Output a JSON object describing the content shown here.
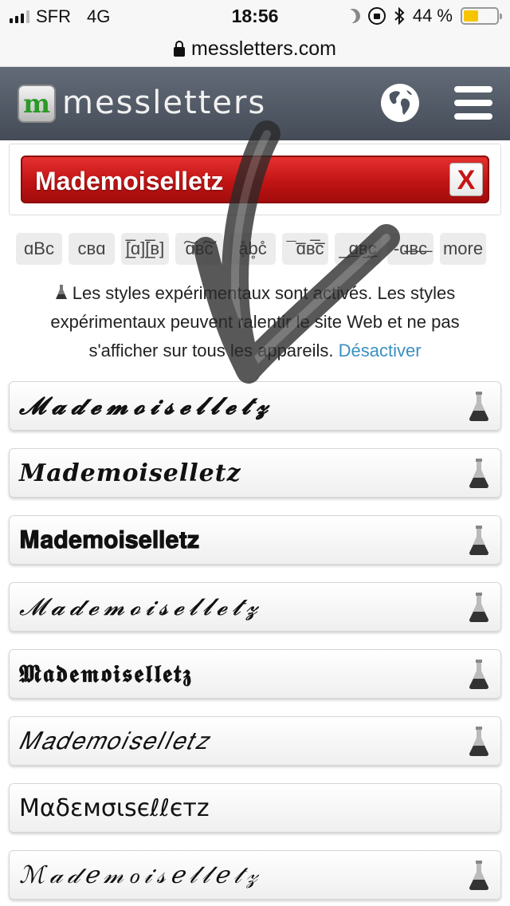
{
  "status": {
    "carrier": "SFR",
    "network": "4G",
    "time": "18:56",
    "battery": "44 %",
    "battery_level": 0.44
  },
  "browser": {
    "url": "messletters.com"
  },
  "header": {
    "brand": "messletters",
    "globe_icon": "globe-icon",
    "menu_icon": "hamburger-menu-icon"
  },
  "input": {
    "value": "Mademoiselletz",
    "clear_label": "X"
  },
  "chips": [
    "ɑBc",
    "cвɑ",
    "[̲̅ɑ][̲̅в]",
    "͠ɑв͠c",
    "ạ̊b̥c̊",
    "¯ɑ̅в̅c̅",
    "_ɑ̲в̲c̲",
    "-ɑ̶в̶c̶",
    "more"
  ],
  "notice": {
    "text": "Les styles expérimentaux sont activés. Les styles expérimentaux peuvent ralentir le site Web et ne pas s'afficher sur tous les appareils.",
    "link": "Désactiver"
  },
  "results": [
    "𝓜𝓪𝓭𝓮𝓶𝓸𝓲𝓼𝓮𝓵𝓵𝓮𝓽𝔃",
    "𝑴𝒂𝒅𝒆𝒎𝒐𝒊𝒔𝒆𝒍𝒍𝒆𝒕𝒛",
    "𝐌𝐚𝐝𝐞𝐦𝐨𝐢𝐬𝐞𝐥𝐥𝐞𝐭𝐳",
    "𝓜𝓪𝓭𝓮𝓶𝓸𝓲𝓼𝓮𝓵𝓵𝓮𝓽𝔃",
    "𝕸𝖆𝖉𝖊𝖒𝖔𝖎𝖘𝖊𝖑𝖑𝖊𝖙𝖟",
    "𝑀𝑎𝑑𝑒𝑚𝑜𝑖𝑠𝑒𝑙𝑙𝑒𝑡𝑧",
    "Mαδεмσιѕєℓℓєтz",
    "ℳ𝒶𝒹ℯ𝓂ℴ𝒾𝓈ℯ𝓁𝓁ℯ𝓉𝓏"
  ]
}
